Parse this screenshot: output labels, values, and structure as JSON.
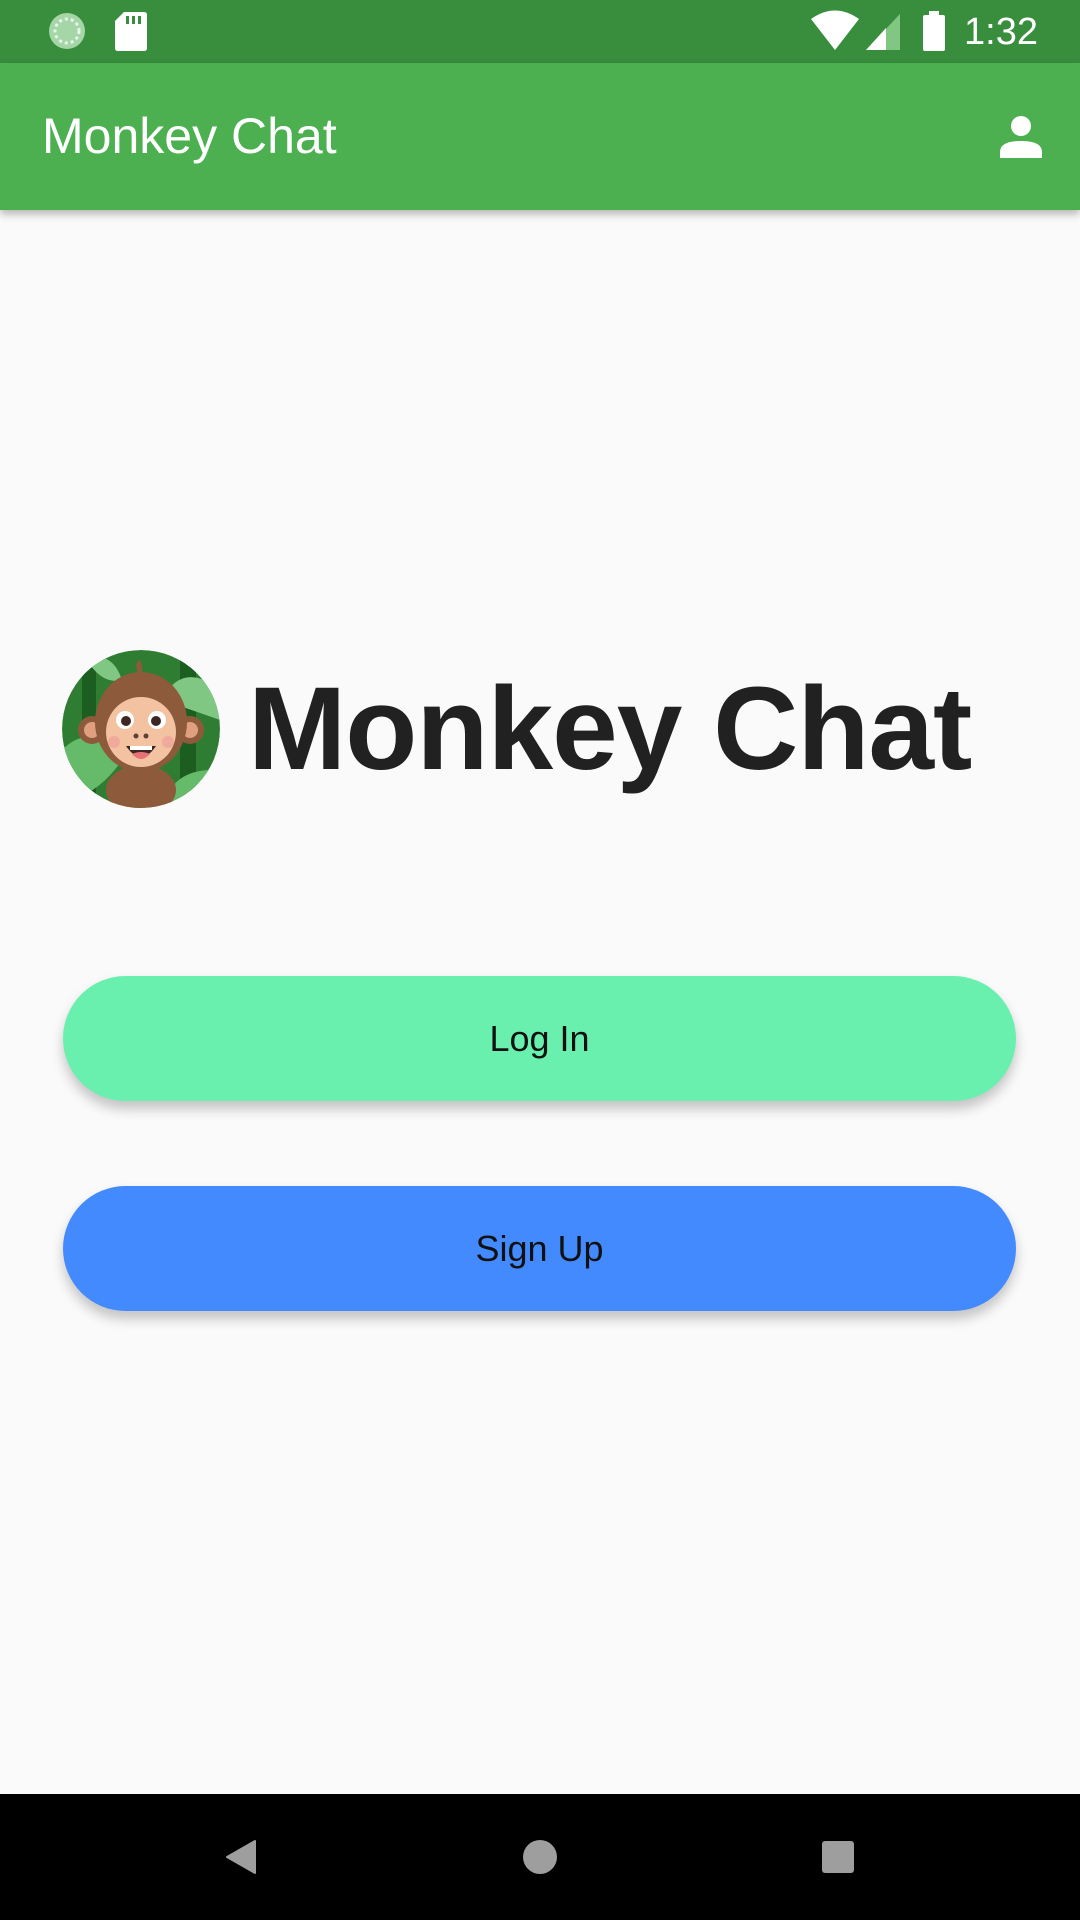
{
  "status_bar": {
    "time": "1:32",
    "icons": [
      "sync-icon",
      "sd-card-icon",
      "wifi-icon",
      "cell-signal-icon",
      "battery-icon"
    ]
  },
  "app_bar": {
    "title": "Monkey Chat",
    "account_icon": "person-icon"
  },
  "brand": {
    "name": "Monkey Chat",
    "logo_icon": "monkey-logo-icon"
  },
  "buttons": {
    "login_label": "Log In",
    "signup_label": "Sign Up"
  },
  "nav_bar": {
    "icons": [
      "back-icon",
      "home-icon",
      "recents-icon"
    ]
  },
  "colors": {
    "status_bar": "#388e3c",
    "app_bar": "#4caf50",
    "login_button": "#69f0ae",
    "signup_button": "#448aff",
    "background": "#fafafa",
    "brand_text": "#212121"
  }
}
